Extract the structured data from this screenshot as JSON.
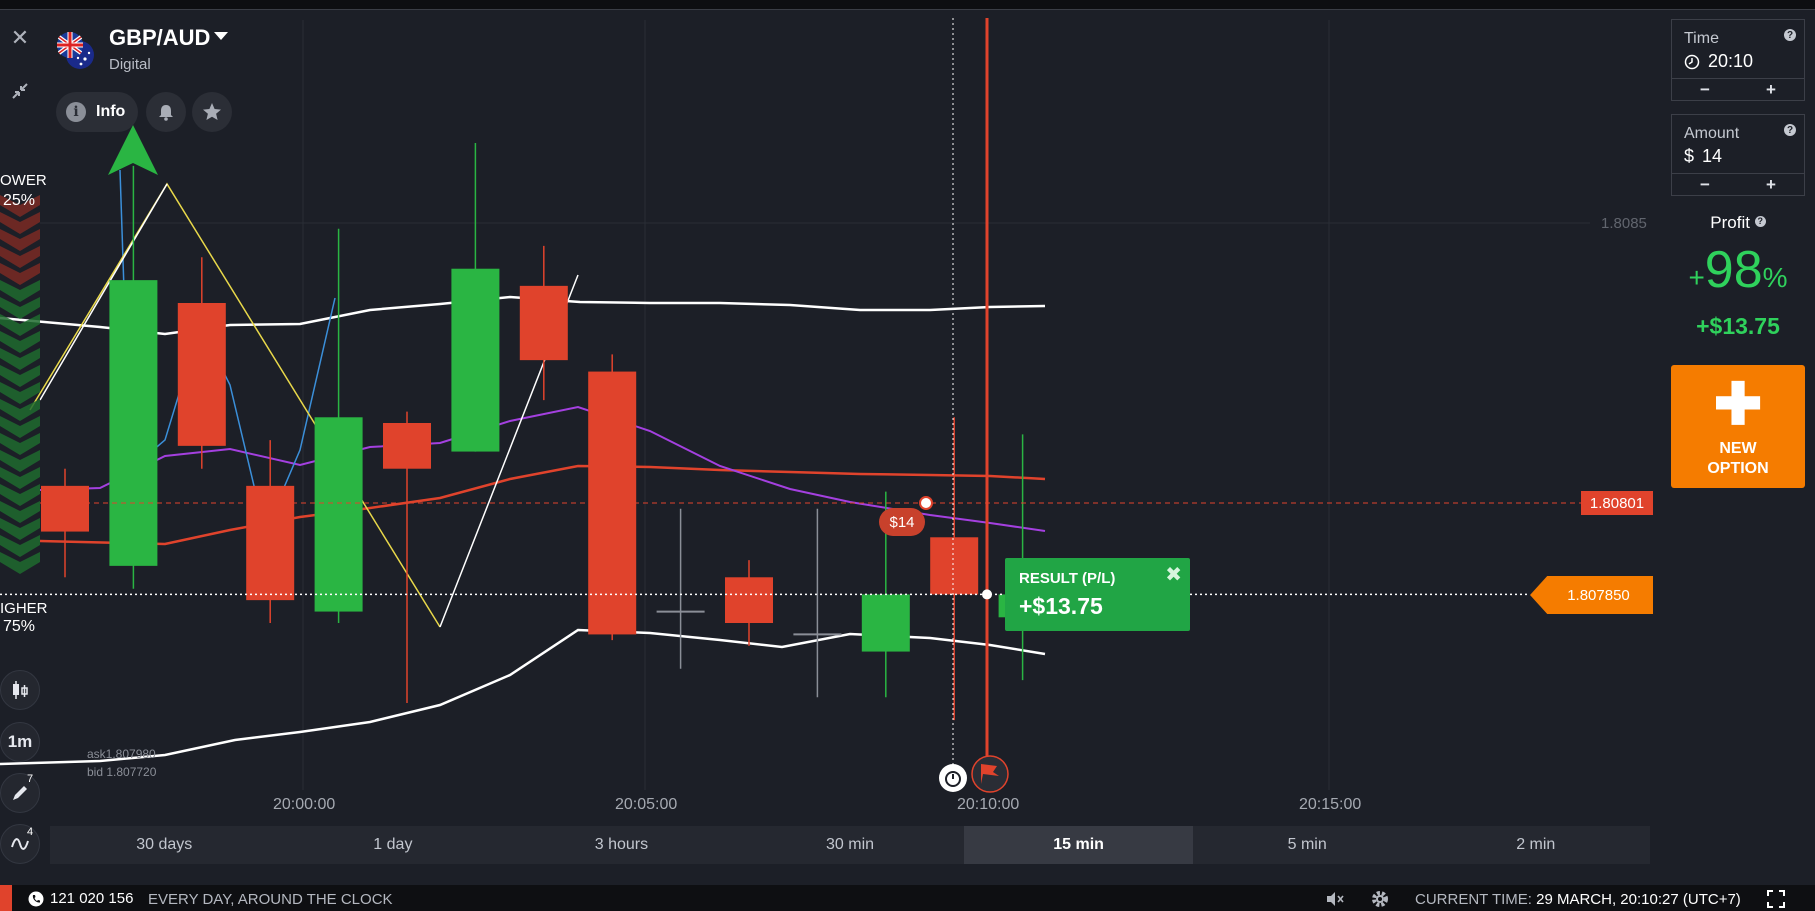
{
  "asset": {
    "name": "GBP/AUD",
    "type": "Digital"
  },
  "header": {
    "info_label": "Info"
  },
  "sentiment": {
    "lower_label": "OWER",
    "lower_pct": "25%",
    "higher_label": "IGHER",
    "higher_pct": "75%"
  },
  "left_toolbar": {
    "timeframe": "1m",
    "draw_count": "7",
    "indicator_count": "4"
  },
  "chart": {
    "price_level_label": "1.8085",
    "strike_price": "1.80801",
    "current_price": "1.807850",
    "ask": "ask1.807980",
    "bid": "bid 1.807720",
    "trade_amount_bubble": "$14",
    "time_labels": [
      "20:00:00",
      "20:05:00",
      "20:10:00",
      "20:15:00"
    ]
  },
  "chart_data": {
    "type": "candlestick",
    "x_axis_ticks": [
      "20:00:00",
      "20:05:00",
      "20:10:00",
      "20:15:00"
    ],
    "y_axis_ticks": [
      "1.8085"
    ],
    "price_lines": {
      "strike": 1.80801,
      "current": 1.80785
    },
    "candles": [
      {
        "o": 1.80796,
        "h": 1.80807,
        "l": 1.80788,
        "c": 1.80804,
        "dir": "down"
      },
      {
        "o": 1.8079,
        "h": 1.8086,
        "l": 1.80786,
        "c": 1.8084,
        "dir": "up"
      },
      {
        "o": 1.80836,
        "h": 1.80844,
        "l": 1.80807,
        "c": 1.80811,
        "dir": "down"
      },
      {
        "o": 1.80804,
        "h": 1.80812,
        "l": 1.8078,
        "c": 1.80784,
        "dir": "down"
      },
      {
        "o": 1.80782,
        "h": 1.80849,
        "l": 1.8078,
        "c": 1.80816,
        "dir": "up"
      },
      {
        "o": 1.80815,
        "h": 1.80817,
        "l": 1.80766,
        "c": 1.80807,
        "dir": "down"
      },
      {
        "o": 1.8081,
        "h": 1.80864,
        "l": 1.8081,
        "c": 1.80842,
        "dir": "up"
      },
      {
        "o": 1.80839,
        "h": 1.80846,
        "l": 1.80819,
        "c": 1.80826,
        "dir": "down"
      },
      {
        "o": 1.80824,
        "h": 1.80827,
        "l": 1.80777,
        "c": 1.80778,
        "dir": "down"
      },
      {
        "o": 1.80782,
        "h": 1.808,
        "l": 1.80772,
        "c": 1.80782,
        "dir": "doji"
      },
      {
        "o": 1.80788,
        "h": 1.80791,
        "l": 1.80776,
        "c": 1.8078,
        "dir": "down"
      },
      {
        "o": 1.80778,
        "h": 1.808,
        "l": 1.80767,
        "c": 1.80778,
        "dir": "doji"
      },
      {
        "o": 1.80775,
        "h": 1.80803,
        "l": 1.80767,
        "c": 1.80785,
        "dir": "up"
      },
      {
        "o": 1.80795,
        "h": 1.80816,
        "l": 1.80763,
        "c": 1.80785,
        "dir": "down"
      },
      {
        "o": 1.80781,
        "h": 1.80813,
        "l": 1.8077,
        "c": 1.80785,
        "dir": "up"
      }
    ]
  },
  "result_popup": {
    "title": "RESULT (P/L)",
    "value": "+$13.75"
  },
  "timeframes": [
    "30 days",
    "1 day",
    "3 hours",
    "30 min",
    "15 min",
    "5 min",
    "2 min"
  ],
  "active_timeframe": "15 min",
  "panel": {
    "time_label": "Time",
    "time_value": "20:10",
    "amount_label": "Amount",
    "amount_currency": "$",
    "amount_value": "14",
    "minus": "−",
    "plus": "+",
    "profit_label": "Profit",
    "profit_sign": "+",
    "profit_pct": "98",
    "profit_pct_unit": "%",
    "profit_amount": "+$13.75",
    "new_option": "NEW\nOPTION"
  },
  "footer": {
    "phone": "121 020 156",
    "slogan": "EVERY DAY, AROUND THE CLOCK",
    "current_time_label": "CURRENT TIME:",
    "current_time_value": "29 MARCH, 20:10:27",
    "timezone": "(UTC+7)"
  },
  "colors": {
    "up": "#2ab543",
    "down": "#e0432c",
    "accent": "#f57c00",
    "profit": "#2fd15c",
    "background": "#1c1f27"
  }
}
